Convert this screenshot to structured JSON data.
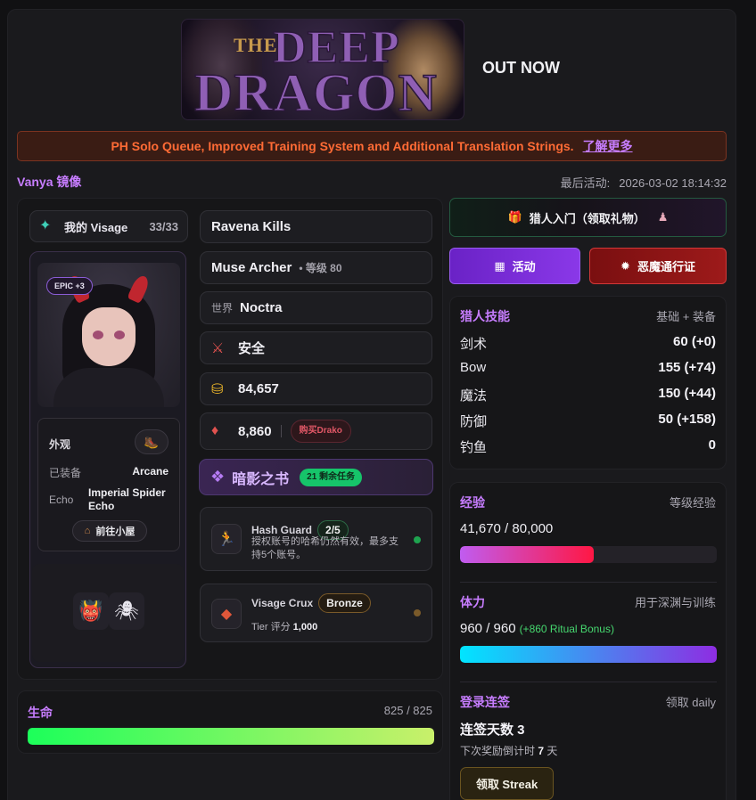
{
  "banner": {
    "logo_the": "THE",
    "logo_deep": "DEEP",
    "logo_dragon": "DRAGON",
    "status": "OUT NOW"
  },
  "announcement": {
    "text": "PH Solo Queue, Improved Training System and Additional Translation Strings.",
    "link": "了解更多"
  },
  "header": {
    "mirror_title": "Vanya 镜像",
    "last_active_label": "最后活动:",
    "last_active_value": "2026-03-02 18:14:32"
  },
  "visage": {
    "label": "我的 Visage",
    "count": "33/33",
    "epic_badge": "EPIC +3",
    "appearance_label": "外观",
    "equipped_label": "已装备",
    "equipped_value": "Arcane",
    "echo_label": "Echo",
    "echo_value": "Imperial Spider Echo",
    "hut_button": "前往小屋"
  },
  "middle": {
    "kills": "Ravena Kills",
    "class_name": "Muse Archer",
    "class_level": "• 等级 80",
    "world_label": "世界",
    "world_value": "Noctra",
    "safety": "安全",
    "gold": "84,657",
    "drako": "8,860",
    "buy_drako": "购买Drako",
    "shadow_book": "暗影之书",
    "shadow_tasks": "21 剩余任务",
    "hash_guard_title": "Hash Guard",
    "hash_guard_count": "2/5",
    "hash_guard_desc": "授权账号的哈希仍然有效，最多支持5个账号。",
    "crux_title": "Visage Crux",
    "crux_tier": "Bronze",
    "crux_score_label": "Tier 评分",
    "crux_score_value": "1,000"
  },
  "right": {
    "gift_button": "猎人入门（领取礼物）",
    "event_button": "活动",
    "pass_button": "恶魔通行证",
    "skills_title": "猎人技能",
    "skills_sub": "基础 + 装备",
    "skills": [
      {
        "name": "剑术",
        "value": "60 (+0)"
      },
      {
        "name": "Bow",
        "value": "155 (+74)"
      },
      {
        "name": "魔法",
        "value": "150 (+44)"
      },
      {
        "name": "防御",
        "value": "50 (+158)"
      },
      {
        "name": "钓鱼",
        "value": "0"
      }
    ],
    "xp_title": "经验",
    "xp_sub": "等级经验",
    "xp_value": "41,670 / 80,000",
    "xp_fraction": 0.521,
    "stamina_title": "体力",
    "stamina_sub": "用于深渊与训练",
    "stamina_value": "960 / 960",
    "stamina_bonus": "(+860 Ritual Bonus)",
    "stamina_fraction": 1.0,
    "streak_title": "登录连签",
    "streak_sub": "领取 daily",
    "streak_days": "连签天数 3",
    "streak_next_prefix": "下次奖励倒计时",
    "streak_next_value": "7",
    "streak_next_suffix": "天",
    "streak_button": "领取 Streak"
  },
  "life": {
    "title": "生命",
    "value": "825 / 825",
    "fraction": 1.0
  },
  "colors": {
    "accent_purple": "#c77dff",
    "announce_orange": "#ff6b35",
    "xp_gradient": [
      "#c05cf0",
      "#ff1744"
    ],
    "stamina_gradient": [
      "#00e5ff",
      "#8e2de2"
    ],
    "life_gradient": [
      "#1cff5a",
      "#c9f06a"
    ]
  }
}
